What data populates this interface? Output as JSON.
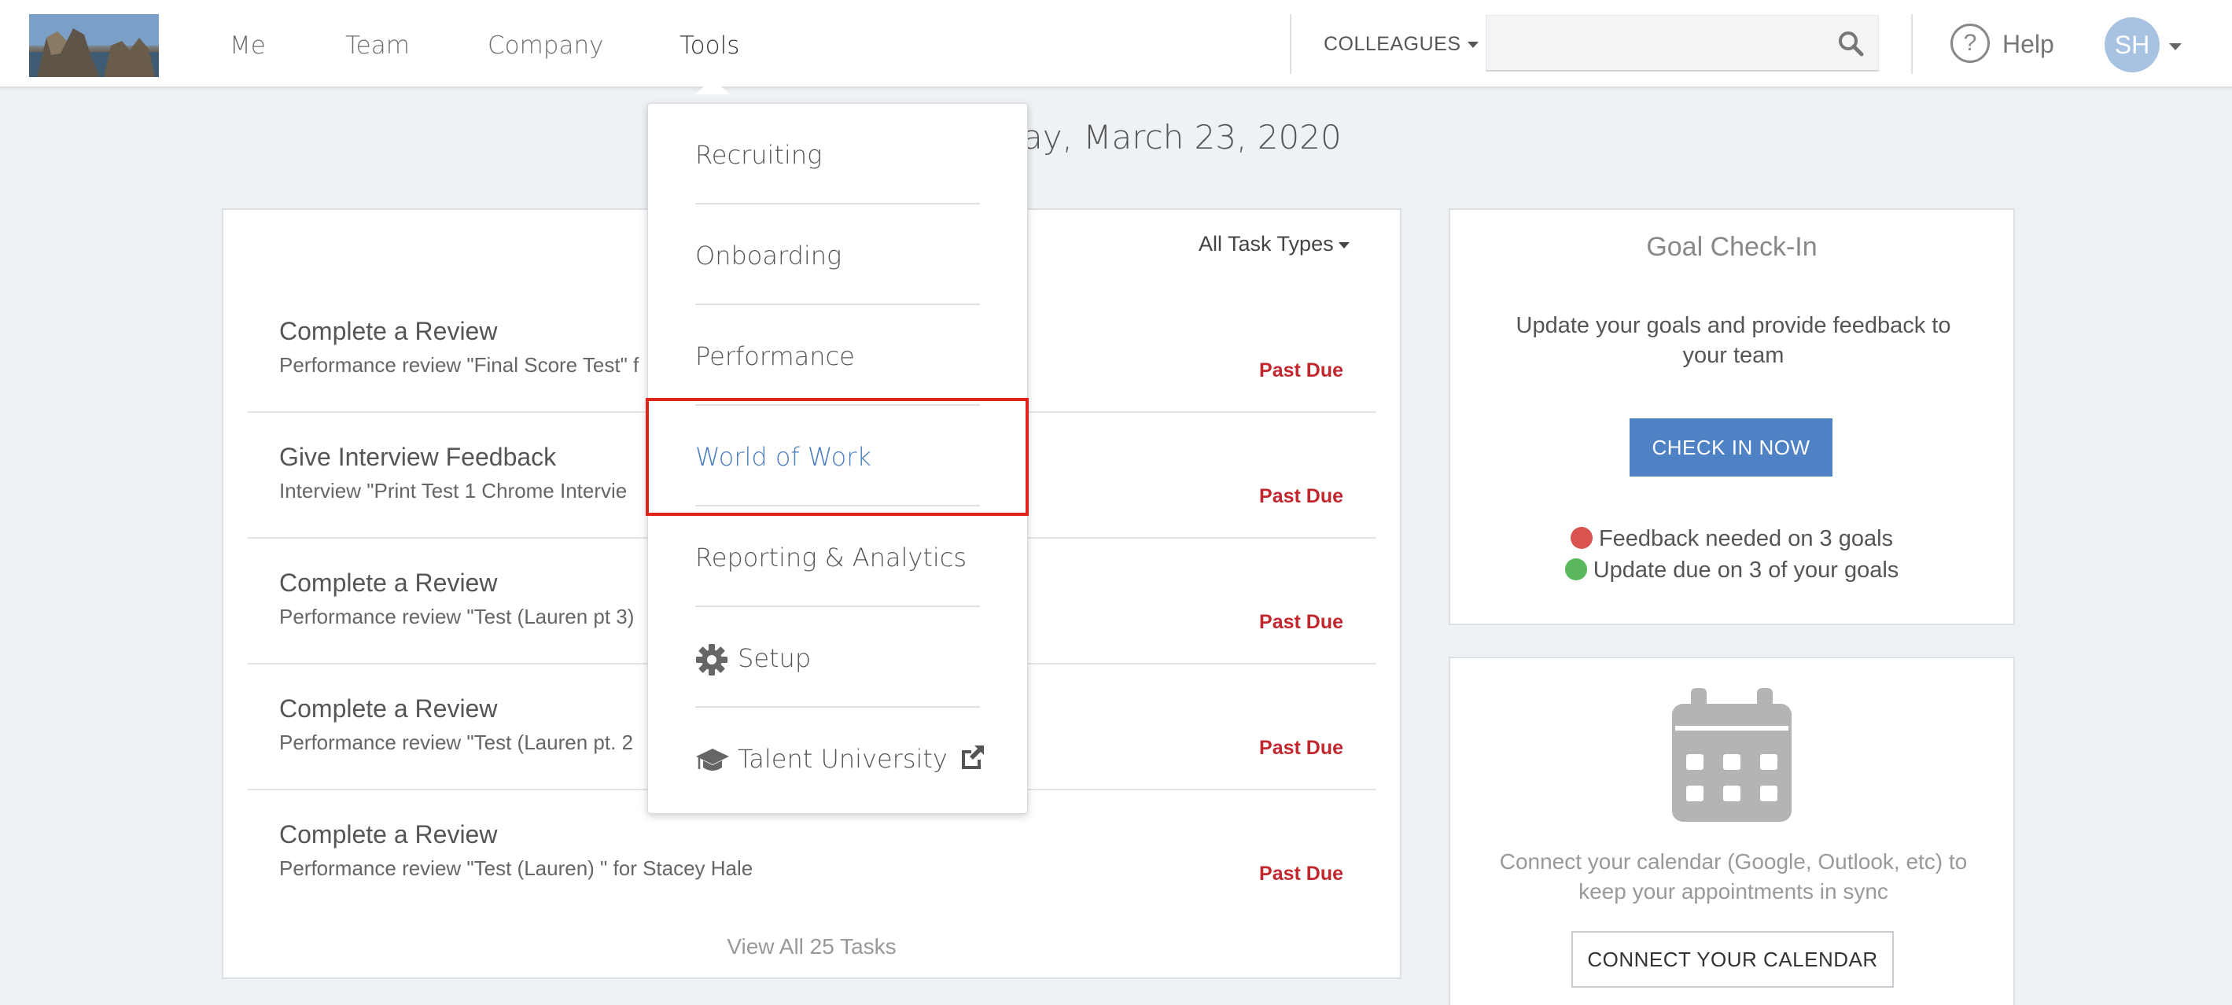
{
  "nav": {
    "items": [
      "Me",
      "Team",
      "Company",
      "Tools"
    ],
    "active": "Tools",
    "colleagues_label": "COLLEAGUES",
    "search_placeholder": "",
    "help_label": "Help",
    "avatar_initials": "SH"
  },
  "page": {
    "date_heading": "ay, March 23, 2020"
  },
  "tasks": {
    "filter_label": "All Task Types",
    "rows": [
      {
        "title": "Complete a Review",
        "subtitle": "Performance review \"Final Score Test\" f",
        "status": "Past Due"
      },
      {
        "title": "Give Interview Feedback",
        "subtitle": "Interview \"Print Test 1 Chrome Intervie",
        "status": "Past Due"
      },
      {
        "title": "Complete a Review",
        "subtitle": "Performance review \"Test (Lauren pt 3)",
        "status": "Past Due"
      },
      {
        "title": "Complete a Review",
        "subtitle": "Performance review \"Test (Lauren pt. 2",
        "status": "Past Due"
      },
      {
        "title": "Complete a Review",
        "subtitle": "Performance review \"Test (Lauren) \" for Stacey Hale",
        "status": "Past Due"
      }
    ],
    "view_all": "View All 25 Tasks"
  },
  "goal_checkin": {
    "title": "Goal Check-In",
    "description": "Update your goals and provide feedback to your team",
    "button": "CHECK IN NOW",
    "stats": [
      {
        "text": "Feedback needed on 3 goals",
        "color": "#d9534f"
      },
      {
        "text": "Update due on 3 of your goals",
        "color": "#5cb85c"
      }
    ]
  },
  "calendar": {
    "text": "Connect your calendar (Google, Outlook, etc) to keep your appointments in sync",
    "button": "CONNECT YOUR CALENDAR"
  },
  "tools_menu": {
    "items": [
      {
        "label": "Recruiting",
        "icon": null
      },
      {
        "label": "Onboarding",
        "icon": null
      },
      {
        "label": "Performance",
        "icon": null
      },
      {
        "label": "World of Work",
        "icon": null,
        "highlighted": true
      },
      {
        "label": "Reporting & Analytics",
        "icon": null
      },
      {
        "label": "Setup",
        "icon": "gear-icon"
      },
      {
        "label": "Talent University",
        "icon": "graduation-cap-icon",
        "trailing_icon": "external-link-icon"
      }
    ]
  },
  "colors": {
    "accent": "#4e82c4",
    "past_due": "#c1272d",
    "highlight_box": "#e0231b",
    "menu_highlight_text": "#4a7ebf"
  }
}
